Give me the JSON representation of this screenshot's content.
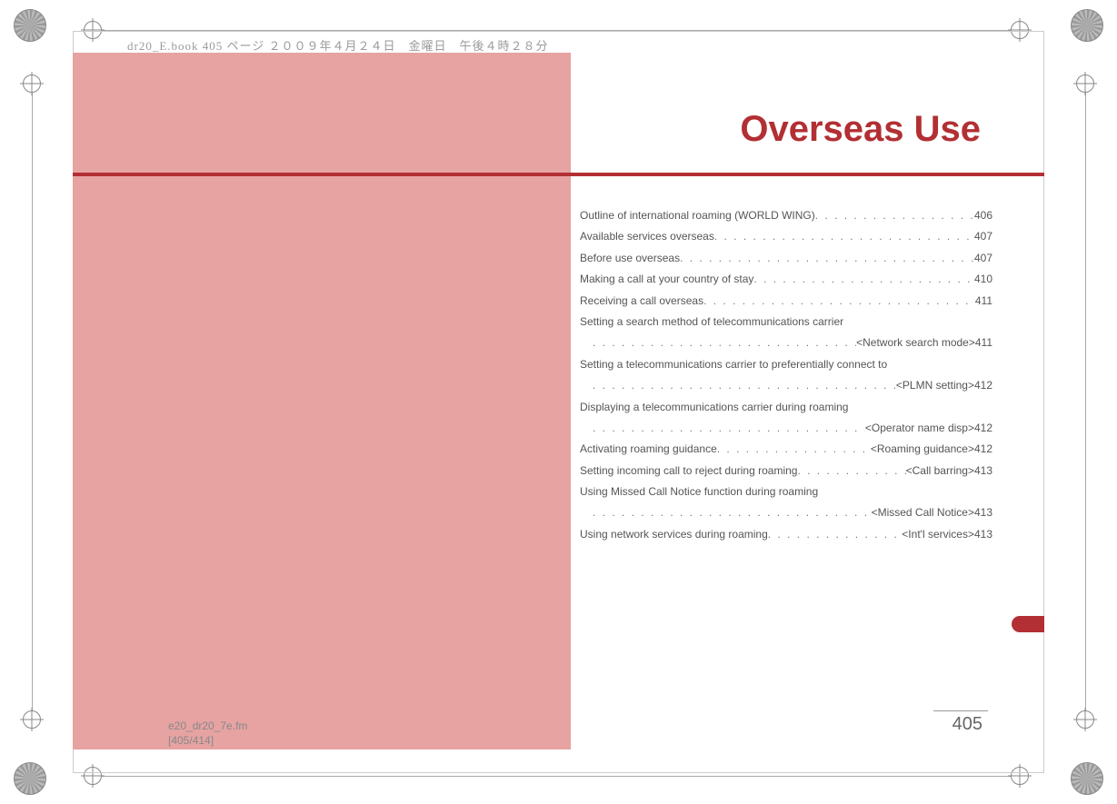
{
  "book_header": "dr20_E.book  405 ページ  ２００９年４月２４日　金曜日　午後４時２８分",
  "chapter_title": "Overseas Use",
  "toc": [
    {
      "label": "Outline of international roaming (WORLD WING)",
      "suffix": "",
      "page": "406"
    },
    {
      "label": "Available services overseas",
      "suffix": "",
      "page": "407"
    },
    {
      "label": "Before use overseas",
      "suffix": "",
      "page": "407"
    },
    {
      "label": "Making a call at your country of stay",
      "suffix": "",
      "page": "410"
    },
    {
      "label": "Receiving a call overseas",
      "suffix": "",
      "page": "411"
    },
    {
      "label": "Setting a search method of telecommunications carrier",
      "cont": true,
      "suffix": " <Network search mode>",
      "page": "411"
    },
    {
      "label": "Setting a telecommunications carrier to preferentially connect to",
      "cont": true,
      "suffix": "<PLMN setting>",
      "page": "412"
    },
    {
      "label": "Displaying a telecommunications carrier during roaming",
      "cont": true,
      "suffix": "<Operator name disp>",
      "page": "412"
    },
    {
      "label": "Activating roaming guidance",
      "suffix": "<Roaming guidance>",
      "page": "412"
    },
    {
      "label": "Setting incoming call to reject during roaming",
      "suffix": " <Call barring>",
      "page": "413"
    },
    {
      "label": "Using Missed Call Notice function during roaming",
      "cont": true,
      "suffix": "<Missed Call Notice>",
      "page": "413"
    },
    {
      "label": "Using network services during roaming",
      "suffix": "<Int'l services>",
      "page": "413"
    }
  ],
  "page_number": "405",
  "footer": {
    "file": "e20_dr20_7e.fm",
    "range": "[405/414]"
  }
}
